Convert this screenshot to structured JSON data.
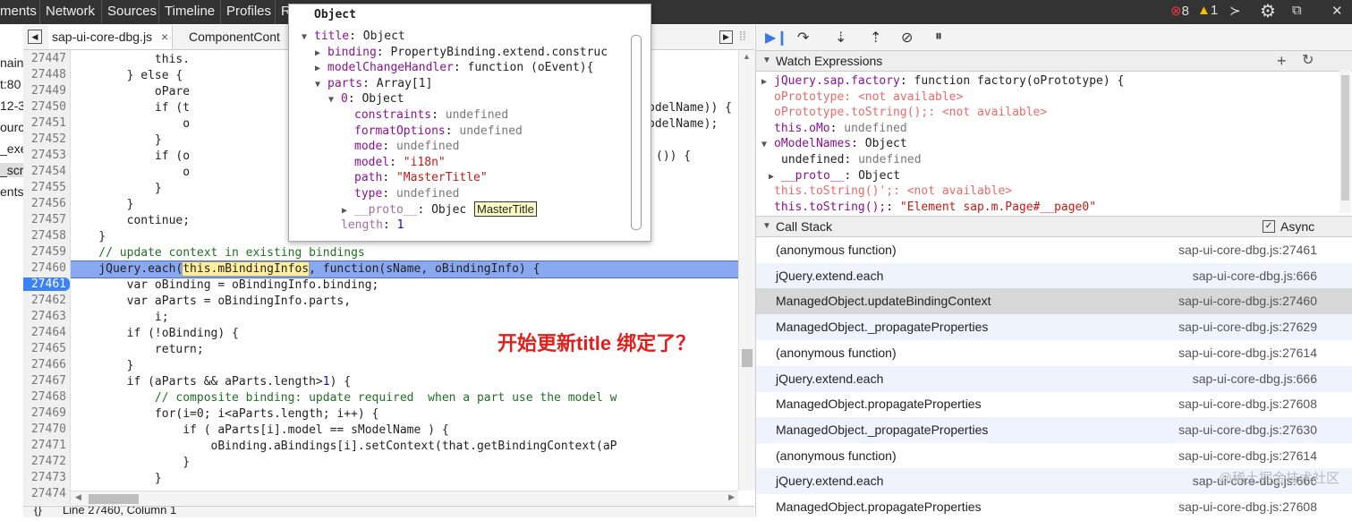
{
  "topbar": {
    "tabs": [
      "ments",
      "Network",
      "Sources",
      "Timeline",
      "Profiles",
      "R"
    ],
    "errors": "8",
    "warnings": "1"
  },
  "filetabs": {
    "active": "sap-ui-core-dbg.js",
    "close": "×",
    "next": "ComponentCont"
  },
  "navigator": {
    "items": [
      "nain)",
      "t:80",
      "12-3",
      "ourc",
      "_exe",
      "_scr",
      "ents"
    ]
  },
  "editor": {
    "line_numbers": [
      "27447",
      "27448",
      "27449",
      "27450",
      "27451",
      "27452",
      "27453",
      "27454",
      "27455",
      "27456",
      "27457",
      "27458",
      "27459",
      "27460",
      "27461",
      "27462",
      "27463",
      "27464",
      "27465",
      "27466",
      "27467",
      "27468",
      "27469",
      "27470",
      "27471",
      "27472",
      "27473",
      "27474"
    ],
    "current_line": "27461",
    "exec_line": "27460",
    "lines": [
      "            this.",
      "        } else {",
      "            oPare",
      "            if (t",
      "                o",
      "            }",
      "            if (o",
      "                o",
      "            }",
      "        }",
      "        continue;",
      "    }",
      "    // update context in existing bindings",
      "    jQuery.each(",
      "        var oBinding = oBindingInfo.binding;",
      "        var aParts = oBindingInfo.parts,",
      "            i;",
      "        if (!oBinding) {",
      "            return;",
      "        }",
      "        if (aParts && aParts.length>",
      "            // composite binding: update required  when a part use the model w",
      "            for(i=0; i<aParts.length; i++) {",
      "                if ( aParts[i].model == sModelName ) {",
      "                    oBinding.aBindings[i].setContext(that.getBindingContext(aP",
      "                }",
      "            }",
      ""
    ],
    "right_fragments": {
      "l27450": "odelName)) {",
      "l27451": "odelName);",
      "l27453": "()) {"
    },
    "exec_highlight": "this.mBindingInfos",
    "exec_rest": ", function(sName, oBindingInfo) {",
    "len_num": "1",
    "len_rest": ") {",
    "status": "Line 27460, Column 1"
  },
  "annotation": "开始更新title 绑定了？",
  "popover": {
    "title": "Object",
    "rows": [
      {
        "k": "title",
        "v": "Object",
        "t": "obj",
        "tri": "▼"
      },
      {
        "k": "binding",
        "v": "PropertyBinding.extend.construc",
        "t": "obj",
        "tri": "▶"
      },
      {
        "k": "modelChangeHandler",
        "v": "function (oEvent){",
        "t": "obj",
        "tri": "▶"
      },
      {
        "k": "parts",
        "v": "Array[1]",
        "t": "obj",
        "tri": "▼"
      },
      {
        "k": "0",
        "v": "Object",
        "t": "obj",
        "tri": "▼"
      },
      {
        "k": "constraints",
        "v": "undefined",
        "t": "und",
        "tri": ""
      },
      {
        "k": "formatOptions",
        "v": "undefined",
        "t": "und",
        "tri": ""
      },
      {
        "k": "mode",
        "v": "undefined",
        "t": "und",
        "tri": ""
      },
      {
        "k": "model",
        "v": "\"i18n\"",
        "t": "str",
        "tri": ""
      },
      {
        "k": "path",
        "v": "\"MasterTitle\"",
        "t": "str",
        "tri": ""
      },
      {
        "k": "type",
        "v": "undefined",
        "t": "und",
        "tri": ""
      },
      {
        "k": "__proto__",
        "v": "Objec",
        "t": "obj",
        "tri": "▶"
      },
      {
        "k": "length",
        "v": "1",
        "t": "num",
        "tri": ""
      }
    ],
    "tooltip": "MasterTitle"
  },
  "watch": {
    "header": "Watch Expressions",
    "rows": [
      {
        "k": "jQuery.sap.factory",
        "v": "function factory(oPrototype) {",
        "t": "obj",
        "tri": "▶"
      },
      {
        "k": "oPrototype",
        "v": "<not available>",
        "t": "na",
        "tri": ""
      },
      {
        "k": "oPrototype.toString();",
        "v": "<not available>",
        "t": "na",
        "tri": ""
      },
      {
        "k": "this.oMo",
        "v": "undefined",
        "t": "und",
        "tri": ""
      },
      {
        "k": "oModelNames",
        "v": "Object",
        "t": "obj",
        "tri": "▼"
      },
      {
        "k": "undefined",
        "v": "undefined",
        "t": "und2",
        "tri": ""
      },
      {
        "k": "__proto__",
        "v": "Object",
        "t": "obj",
        "tri": "▶"
      },
      {
        "k": "this.toString()';",
        "v": "<not available>",
        "t": "na",
        "tri": ""
      },
      {
        "k": "this.toString();",
        "v": "\"Element sap.m.Page#__page0\"",
        "t": "str",
        "tri": ""
      }
    ]
  },
  "callstack": {
    "header": "Call Stack",
    "async_label": "Async",
    "frames": [
      {
        "fn": "(anonymous function)",
        "loc": "sap-ui-core-dbg.js:27461"
      },
      {
        "fn": "jQuery.extend.each",
        "loc": "sap-ui-core-dbg.js:666"
      },
      {
        "fn": "ManagedObject.updateBindingContext",
        "loc": "sap-ui-core-dbg.js:27460"
      },
      {
        "fn": "ManagedObject._propagateProperties",
        "loc": "sap-ui-core-dbg.js:27629"
      },
      {
        "fn": "(anonymous function)",
        "loc": "sap-ui-core-dbg.js:27614"
      },
      {
        "fn": "jQuery.extend.each",
        "loc": "sap-ui-core-dbg.js:666"
      },
      {
        "fn": "ManagedObject.propagateProperties",
        "loc": "sap-ui-core-dbg.js:27608"
      },
      {
        "fn": "ManagedObject._propagateProperties",
        "loc": "sap-ui-core-dbg.js:27630"
      },
      {
        "fn": "(anonymous function)",
        "loc": "sap-ui-core-dbg.js:27614"
      },
      {
        "fn": "jQuery.extend.each",
        "loc": "sap-ui-core-dbg.js:666"
      },
      {
        "fn": "ManagedObject.propagateProperties",
        "loc": "sap-ui-core-dbg.js:27608"
      }
    ]
  },
  "watermark": "@稀土掘金技术社区"
}
